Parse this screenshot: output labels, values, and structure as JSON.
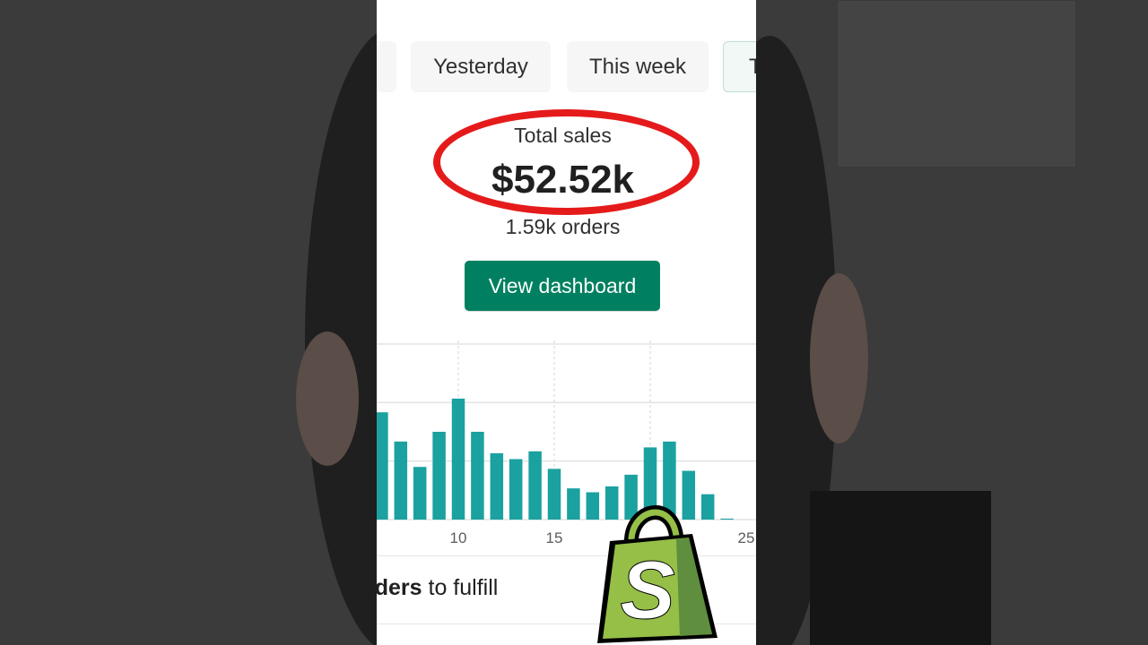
{
  "date_chips": [
    {
      "label": ""
    },
    {
      "label": "Yesterday"
    },
    {
      "label": "This week"
    },
    {
      "label": "T"
    }
  ],
  "summary": {
    "label": "Total sales",
    "value": "$52.52k",
    "orders": "1.59k orders"
  },
  "actions": {
    "view_dashboard": "View dashboard"
  },
  "chart_data": {
    "type": "bar",
    "x": [
      6,
      7,
      8,
      9,
      10,
      11,
      12,
      13,
      14,
      15,
      16,
      17,
      18,
      19,
      20,
      21,
      22,
      23,
      24,
      25
    ],
    "values": [
      55,
      40,
      27,
      45,
      62,
      45,
      34,
      31,
      35,
      26,
      16,
      14,
      17,
      23,
      37,
      40,
      25,
      13,
      0.5,
      0
    ],
    "xticks": [
      "10",
      "15",
      "25"
    ],
    "xlim": [
      5.5,
      25.5
    ],
    "ylim": [
      0,
      90
    ],
    "grid": true,
    "color": "#1aa1a0"
  },
  "todo": {
    "prefix": "rders",
    "suffix": " to fulfill"
  },
  "branding": {
    "logo_letter": "S",
    "bag_color": "#95bf47",
    "bag_shade": "#5e8e3e"
  }
}
